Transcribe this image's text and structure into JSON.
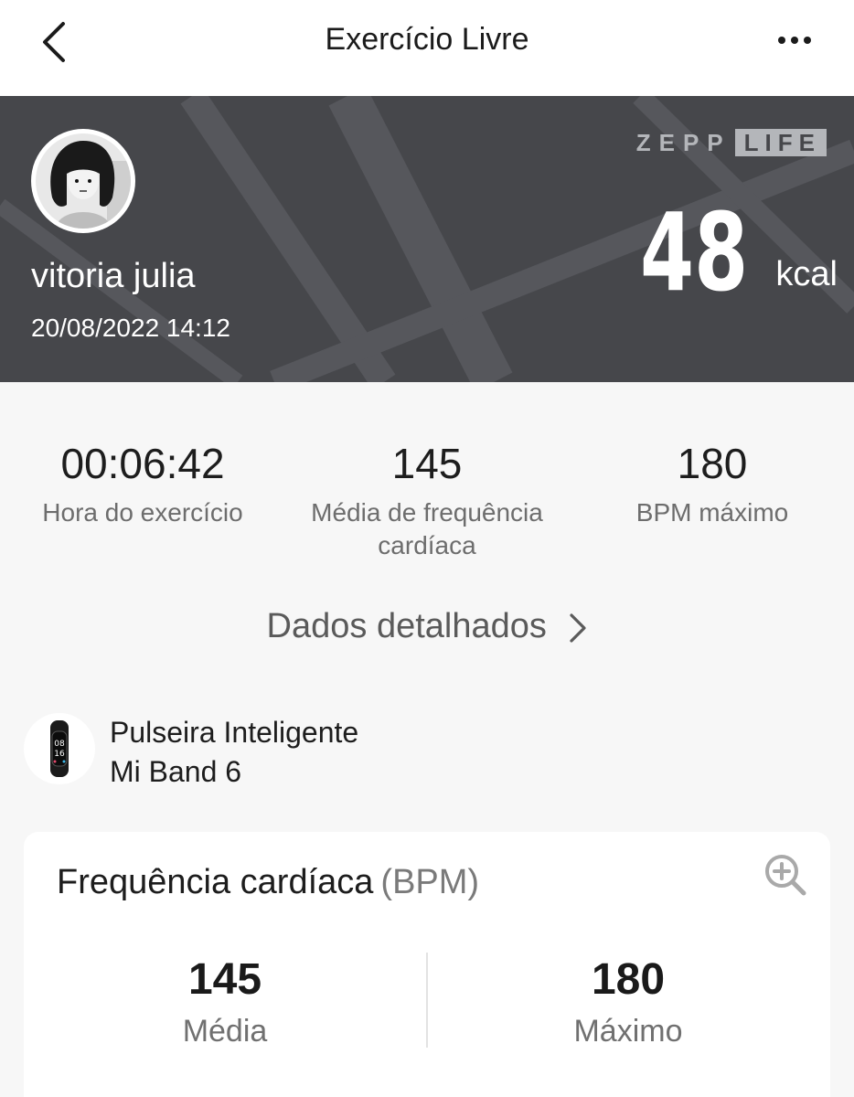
{
  "header": {
    "title": "Exercício Livre"
  },
  "hero": {
    "user_name": "vitoria julia",
    "datetime": "20/08/2022 14:12",
    "brand_left": "ZEPP",
    "brand_right": "LIFE",
    "calories": "48",
    "calories_unit": "kcal",
    "background_color": "#46474b"
  },
  "stats": [
    {
      "value": "00:06:42",
      "label": "Hora do exercício"
    },
    {
      "value": "145",
      "label": "Média de frequência cardíaca"
    },
    {
      "value": "180",
      "label": "BPM máximo"
    }
  ],
  "details_link": "Dados detalhados",
  "device": {
    "name_line1": "Pulseira Inteligente",
    "name_line2": "Mi Band 6",
    "screen_top": "08",
    "screen_bottom": "16"
  },
  "heart_rate_card": {
    "title": "Frequência cardíaca",
    "unit": "(BPM)",
    "average_value": "145",
    "average_label": "Média",
    "max_value": "180",
    "max_label": "Máximo"
  }
}
